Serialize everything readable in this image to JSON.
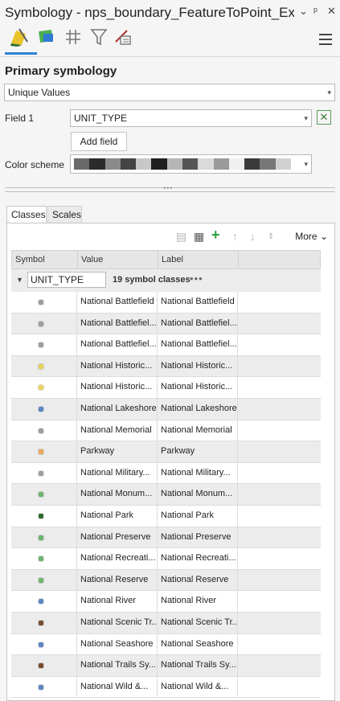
{
  "window": {
    "title": "Symbology - nps_boundary_FeatureToPoint_Expo...",
    "controls": [
      "⌄",
      "ᵖ",
      "✕"
    ]
  },
  "toolbar": {
    "tools": [
      "primary-symbology-icon",
      "vary-symbology-icon",
      "label-classes-icon",
      "filter-icon",
      "symbol-layer-drawing-icon"
    ],
    "menu_icon": "hamburger-menu-icon"
  },
  "primary": {
    "heading": "Primary symbology",
    "renderer": "Unique Values",
    "field_label": "Field 1",
    "field_value": "UNIT_TYPE",
    "add_field": "Add field",
    "color_scheme_label": "Color scheme",
    "color_scheme": [
      "#6a6a6a",
      "#2b2b2b",
      "#8a8a8a",
      "#444444",
      "#c8c8c8",
      "#1f1f1f",
      "#b5b5b5",
      "#555555",
      "#dadada",
      "#9a9a9a",
      "#f0f0f0",
      "#3a3a3a",
      "#777777",
      "#d0d0d0"
    ]
  },
  "tabs": [
    "Classes",
    "Scales"
  ],
  "classes_toolbar": {
    "more_label": "More"
  },
  "table": {
    "columns": [
      "Symbol",
      "Value",
      "Label"
    ],
    "group_field": "UNIT_TYPE",
    "class_count": "19 symbol classes",
    "rows": [
      {
        "value": "National Battlefield",
        "label": "National Battlefield",
        "color": "#9e9e9e"
      },
      {
        "value": "National Battlefiel...",
        "label": "National Battlefiel...",
        "color": "#9e9e9e"
      },
      {
        "value": "National Battlefiel...",
        "label": "National Battlefiel...",
        "color": "#9e9e9e"
      },
      {
        "value": "National Historic...",
        "label": "National Historic...",
        "color": "#e8d45a"
      },
      {
        "value": "National Historic...",
        "label": "National Historic...",
        "color": "#e8d45a"
      },
      {
        "value": "National Lakeshore",
        "label": "National Lakeshore",
        "color": "#5b86c4"
      },
      {
        "value": "National Memorial",
        "label": "National Memorial",
        "color": "#9e9e9e"
      },
      {
        "value": "Parkway",
        "label": "Parkway",
        "color": "#f0a85a"
      },
      {
        "value": "National Military...",
        "label": "National Military...",
        "color": "#9e9e9e"
      },
      {
        "value": "National Monum...",
        "label": "National Monum...",
        "color": "#6cb56c"
      },
      {
        "value": "National Park",
        "label": "National Park",
        "color": "#2e6b2e"
      },
      {
        "value": "National Preserve",
        "label": "National Preserve",
        "color": "#6cb56c"
      },
      {
        "value": "National Recreati...",
        "label": "National Recreati...",
        "color": "#6cb56c"
      },
      {
        "value": "National Reserve",
        "label": "National Reserve",
        "color": "#6cb56c"
      },
      {
        "value": "National River",
        "label": "National River",
        "color": "#5b86c4"
      },
      {
        "value": "National Scenic Tr...",
        "label": "National Scenic Tr...",
        "color": "#7a4b2a"
      },
      {
        "value": "National Seashore",
        "label": "National Seashore",
        "color": "#5b86c4"
      },
      {
        "value": "National Trails Sy...",
        "label": "National Trails Sy...",
        "color": "#7a4b2a"
      },
      {
        "value": "National Wild &...",
        "label": "National Wild &...",
        "color": "#5b86c4"
      }
    ]
  }
}
